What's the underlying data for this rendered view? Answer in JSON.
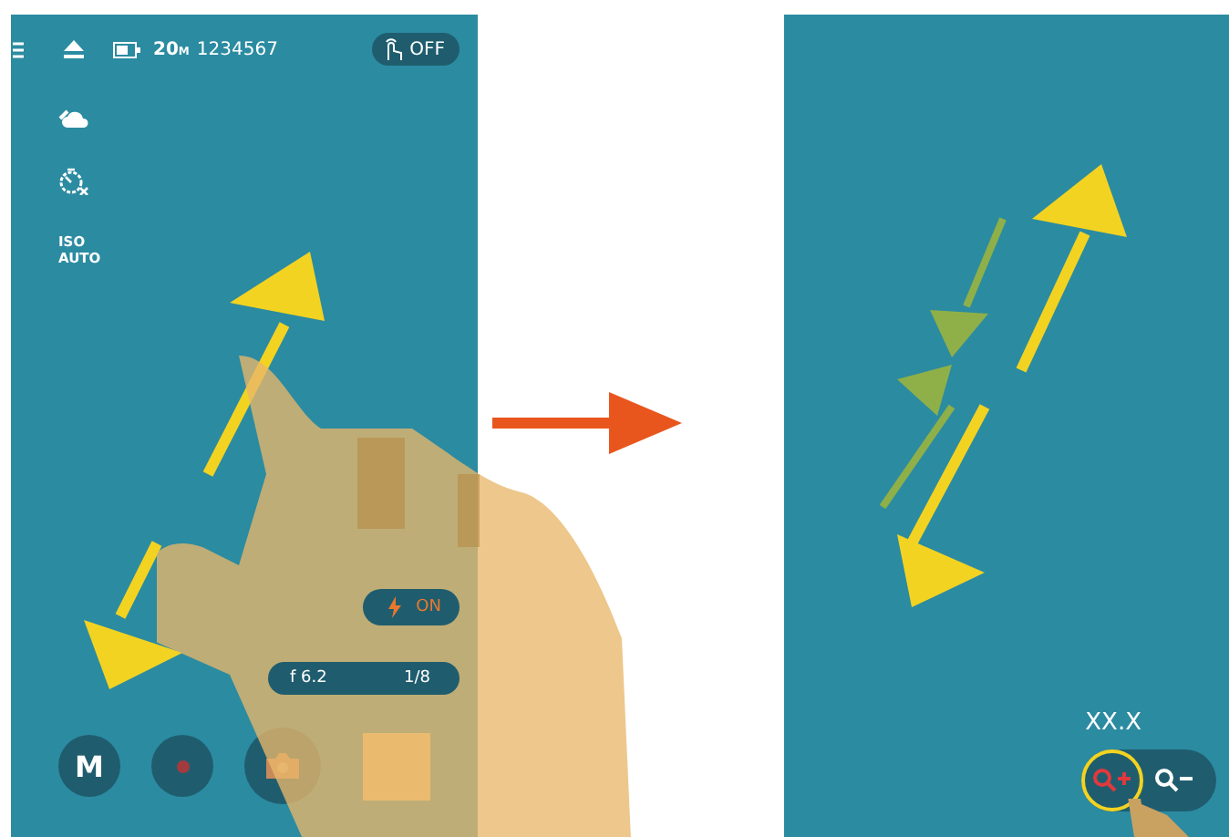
{
  "left_screen": {
    "top_bar": {
      "image_size": "20",
      "image_size_unit": "M",
      "shots_remaining": "1234567",
      "touch_shutter": "OFF"
    },
    "side_items": [
      {
        "kind": "cloud"
      },
      {
        "kind": "timer"
      },
      {
        "kind": "iso",
        "label": "ISO AUTO"
      }
    ],
    "flash": {
      "label": "ON"
    },
    "exposure": {
      "aperture": "f 6.2",
      "shutter_speed": "1/8"
    },
    "bottom_buttons": [
      {
        "kind": "mode",
        "label": "M"
      },
      {
        "kind": "record"
      },
      {
        "kind": "shutter"
      },
      {
        "kind": "thumbnail"
      }
    ]
  },
  "right_screen": {
    "zoom_value": "XX.X",
    "zoom_buttons": [
      {
        "kind": "zoom-in",
        "selected": true
      },
      {
        "kind": "zoom-out",
        "selected": false
      }
    ]
  }
}
